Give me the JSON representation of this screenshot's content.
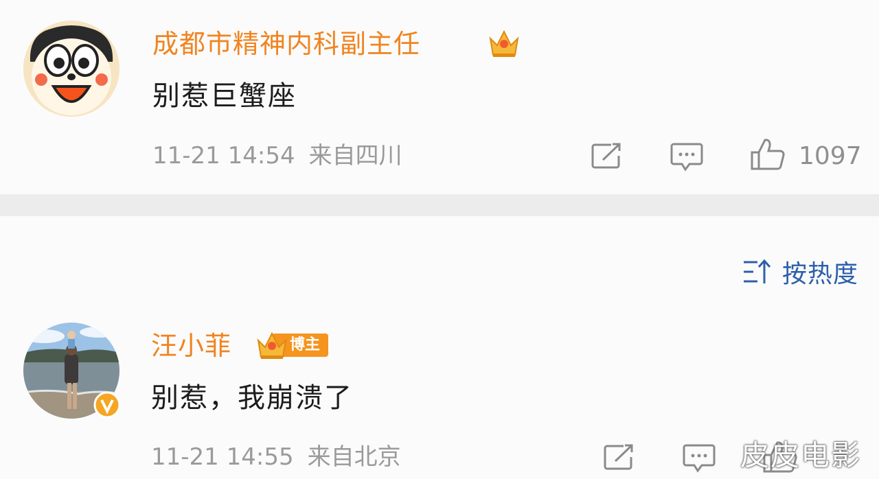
{
  "comments": [
    {
      "username": "成都市精神内科副主任",
      "content": "别惹巨蟹座",
      "time": "11-21 14:54",
      "location": "来自四川",
      "likes": "1097",
      "badge_icon": "crown-icon"
    },
    {
      "username": "汪小菲",
      "badge_label": "博主",
      "content": "别惹，我崩溃了",
      "time": "11-21 14:55",
      "location": "来自北京",
      "likes": "",
      "badge_icon": "crown-icon",
      "verified_icon": "verified-v-icon"
    }
  ],
  "sort": {
    "label": "按热度",
    "icon": "sort-icon"
  },
  "watermark": "皮皮电影",
  "colors": {
    "username": "#f08420",
    "sort": "#2d5faa",
    "meta": "#9a9a9a",
    "divider": "#ececec"
  }
}
